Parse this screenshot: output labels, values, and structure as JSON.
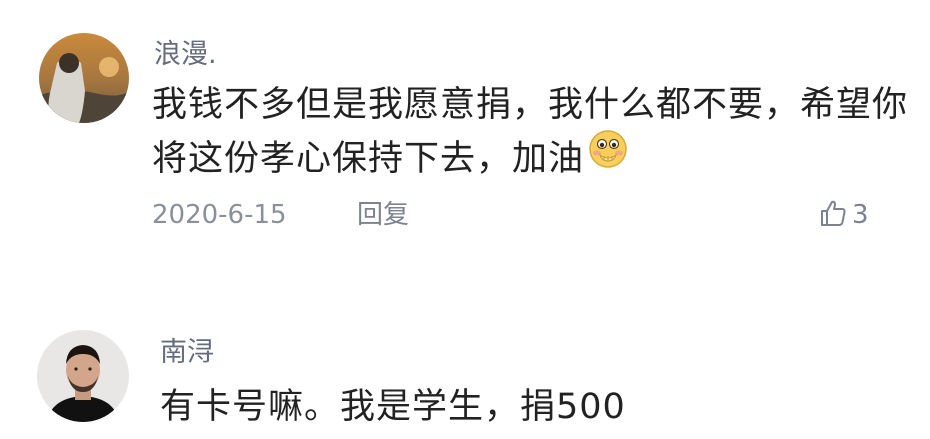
{
  "comments": [
    {
      "username": "浪漫.",
      "content_lines": [
        "我钱不多但是我愿意捐，我什么都不要，希望你",
        "将这份孝心保持下去，加油"
      ],
      "emoji": "shy-face-emoji",
      "date": "2020-6-15",
      "reply_label": "回复",
      "like_count": "3",
      "like_icon": "thumbs-up-icon",
      "avatar": "sunset-photo-avatar"
    },
    {
      "username": "南浔",
      "content": "有卡号嘛。我是学生，捐500",
      "avatar": "man-portrait-avatar"
    }
  ],
  "colors": {
    "username": "#646c7d",
    "content": "#222222",
    "meta": "#8a8f99"
  }
}
